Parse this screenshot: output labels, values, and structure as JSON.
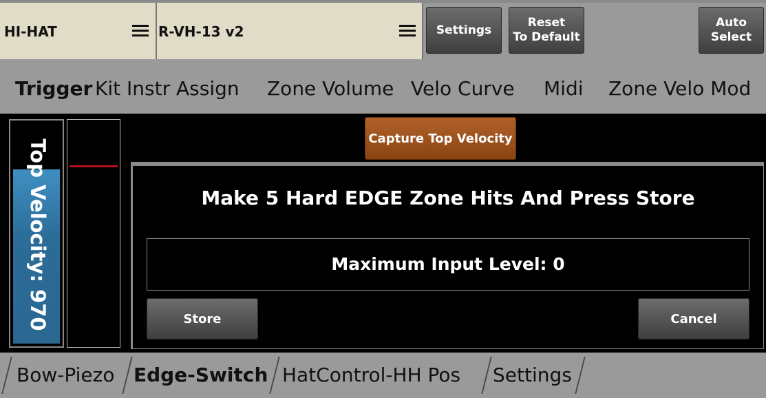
{
  "top_bar": {
    "instrument_selector": {
      "value": "HI-HAT",
      "menu_icon": "hamburger-menu-icon"
    },
    "model_selector": {
      "value": "R-VH-13 v2",
      "menu_icon": "hamburger-menu-icon"
    },
    "settings_button": "Settings",
    "reset_button": "Reset\nTo Default",
    "auto_select_button": "Auto\nSelect"
  },
  "tabs": [
    {
      "label": "Trigger",
      "active": true
    },
    {
      "label": "Kit Instr Assign",
      "active": false
    },
    {
      "label": "Zone Volume",
      "active": false
    },
    {
      "label": "Velo Curve",
      "active": false
    },
    {
      "label": "Midi",
      "active": false
    },
    {
      "label": "Zone Velo Mod",
      "active": false
    }
  ],
  "velocity_meter": {
    "label": "Top Velocity: 970",
    "fill_fraction": 0.79
  },
  "input_level_meter": {
    "marker_fraction": 0.8
  },
  "capture_button": "Capture Top Velocity",
  "dialog": {
    "title": "Make 5 Hard EDGE Zone Hits And Press Store",
    "level_text": "Maximum Input Level: 0",
    "store_button": "Store",
    "cancel_button": "Cancel"
  },
  "bottom_tabs": [
    {
      "label": "Bow-Piezo",
      "active": false
    },
    {
      "label": "Edge-Switch",
      "active": true
    },
    {
      "label": "HatControl-HH Pos",
      "active": false
    },
    {
      "label": "Settings",
      "active": false
    }
  ],
  "colors": {
    "background_gray": "#9a9a9a",
    "selector_beige": "#e1dcc8",
    "capture_orange": "#9c5220",
    "meter_blue": "#2f75a6",
    "marker_red": "#b3121a"
  }
}
